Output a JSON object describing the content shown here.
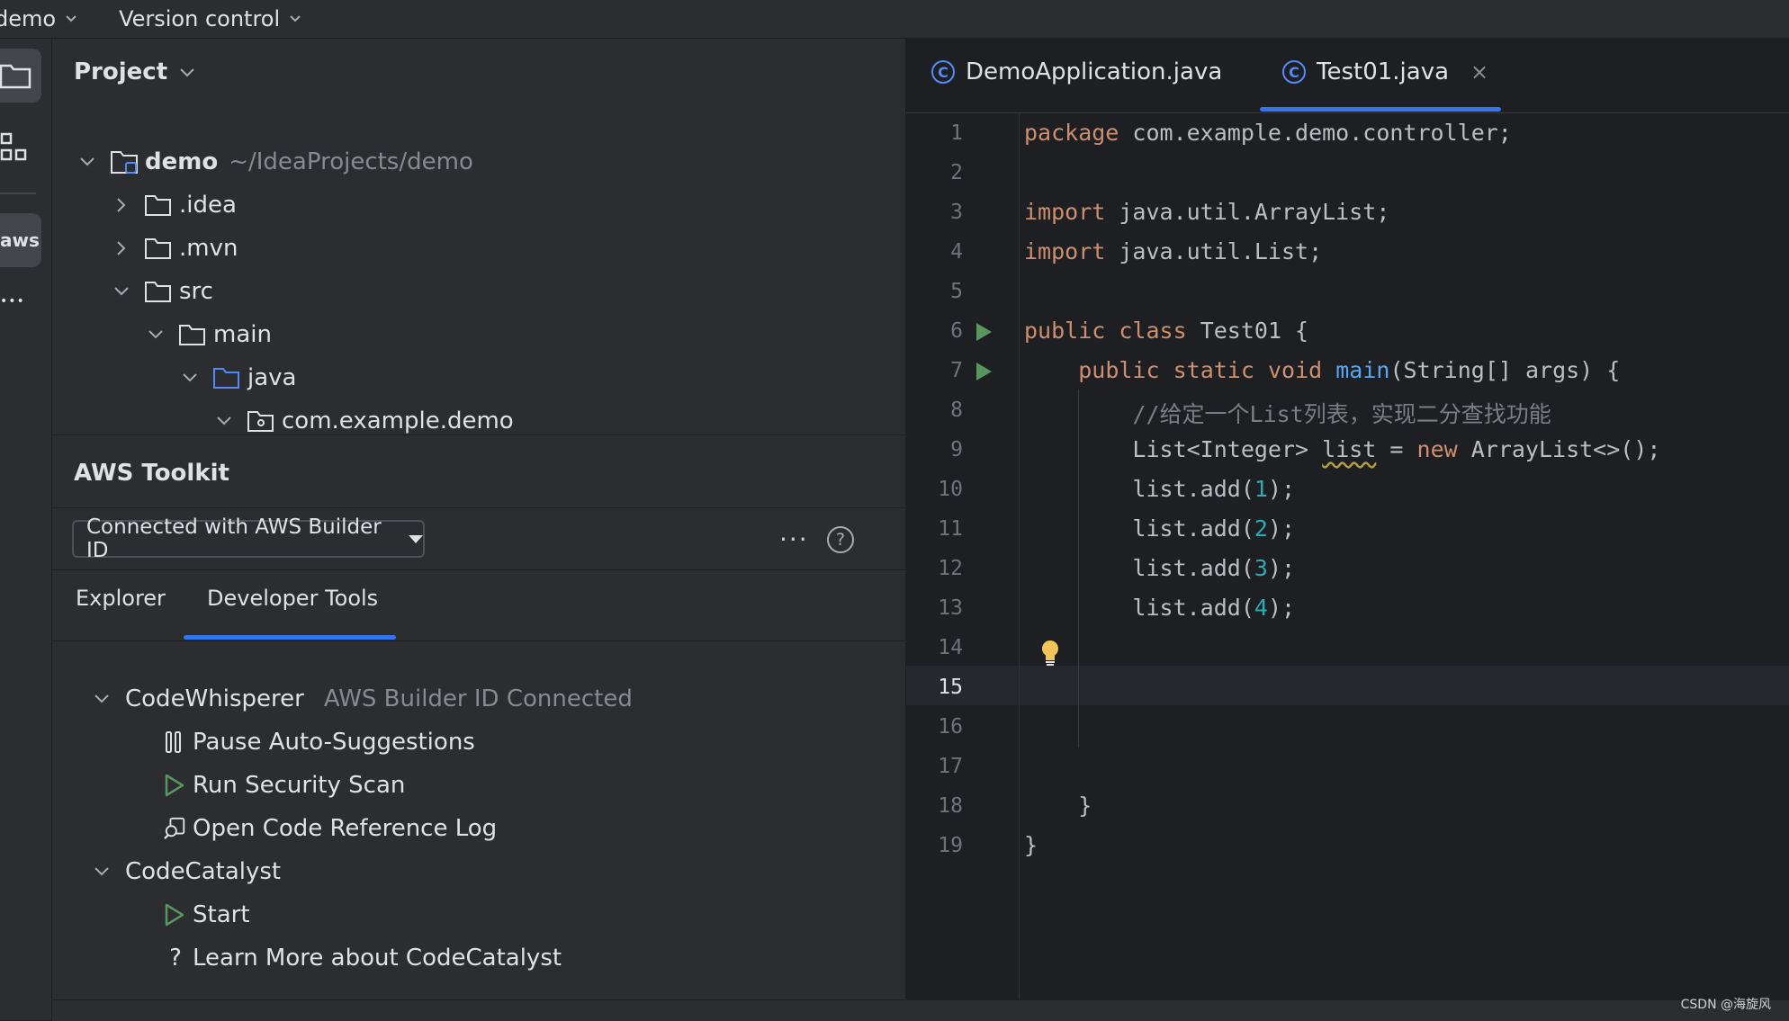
{
  "topbar": {
    "project_menu": "demo",
    "vcs_menu": "Version control"
  },
  "toolstrip": {
    "aws_label": "aws",
    "more": "•••"
  },
  "project_panel": {
    "title": "Project",
    "tree": [
      {
        "label": "demo",
        "path": "~/IdeaProjects/demo"
      },
      {
        "label": ".idea"
      },
      {
        "label": ".mvn"
      },
      {
        "label": "src"
      },
      {
        "label": "main"
      },
      {
        "label": "java"
      },
      {
        "label": "com.example.demo"
      }
    ]
  },
  "aws_toolkit": {
    "title": "AWS Toolkit",
    "connection": "Connected with AWS Builder ID",
    "more": "···",
    "help": "?",
    "tabs": [
      "Explorer",
      "Developer Tools"
    ],
    "active_tab": "Developer Tools",
    "tree": {
      "codewhisperer": {
        "label": "CodeWhisperer",
        "status": "AWS Builder ID Connected",
        "items": [
          "Pause Auto-Suggestions",
          "Run Security Scan",
          "Open Code Reference Log"
        ]
      },
      "codecatalyst": {
        "label": "CodeCatalyst",
        "items": [
          "Start",
          "Learn More about CodeCatalyst"
        ]
      }
    }
  },
  "editor": {
    "tabs": [
      {
        "label": "DemoApplication.java",
        "icon": "C"
      },
      {
        "label": "Test01.java",
        "icon": "C",
        "close": "×"
      }
    ],
    "active_tab": "Test01.java",
    "current_line": 15,
    "line_numbers": [
      "1",
      "2",
      "3",
      "4",
      "5",
      "6",
      "7",
      "8",
      "9",
      "10",
      "11",
      "12",
      "13",
      "14",
      "15",
      "16",
      "17",
      "18",
      "19"
    ],
    "code": {
      "l1": {
        "kw": "package",
        "rest": " com.example.demo.controller;"
      },
      "l3": {
        "kw": "import",
        "rest": " java.util.ArrayList;"
      },
      "l4": {
        "kw": "import",
        "rest": " java.util.List;"
      },
      "l6": {
        "kw1": "public",
        "kw2": "class",
        "rest": " Test01 {"
      },
      "l7": {
        "indent": "    ",
        "kw1": "public",
        "kw2": "static",
        "kw3": "void",
        "fn": "main",
        "rest": "(String[] args) {"
      },
      "l8": {
        "indent": "        ",
        "comment": "//给定一个List列表，实现二分查找功能"
      },
      "l9": {
        "indent": "        ",
        "pre": "List<Integer> ",
        "var": "list",
        "mid": " = ",
        "kw": "new",
        "rest": " ArrayList<>();"
      },
      "l10": {
        "indent": "        ",
        "pre": "list.add(",
        "num": "1",
        "rest": ");"
      },
      "l11": {
        "indent": "        ",
        "pre": "list.add(",
        "num": "2",
        "rest": ");"
      },
      "l12": {
        "indent": "        ",
        "pre": "list.add(",
        "num": "3",
        "rest": ");"
      },
      "l13": {
        "indent": "        ",
        "pre": "list.add(",
        "num": "4",
        "rest": ");"
      },
      "l17": {
        "text": "    }"
      },
      "l18": {
        "text": "}"
      }
    }
  },
  "watermark": "CSDN @海旋风",
  "colors": {
    "accent": "#3574f0",
    "keyword": "#cf8e6d",
    "function": "#56a8f5",
    "number": "#2aacb8",
    "comment": "#7a7e85",
    "run": "#57965c"
  }
}
